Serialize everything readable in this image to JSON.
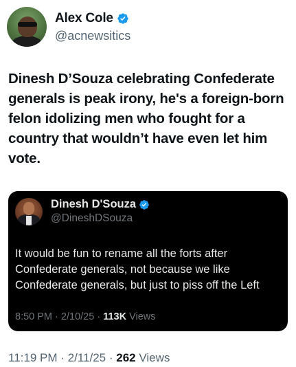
{
  "author": {
    "display_name": "Alex Cole",
    "handle": "@acnewsitics"
  },
  "tweet": {
    "text": "Dinesh D’Souza celebrating Confederate generals is peak irony, he's a foreign-born felon idolizing men who fought for a country that wouldn’t have even let him vote."
  },
  "quoted_tweet": {
    "display_name": "Dinesh D'Souza",
    "handle": "@DineshDSouza",
    "text": "It would be fun to rename all the forts after Confederate generals, not because we like Confederate generals, but just to piss off the Left",
    "time": "8:50 PM",
    "separator": "·",
    "date": "2/10/25",
    "views_count": "113K",
    "views_label": "Views"
  },
  "meta": {
    "time": "11:19 PM",
    "separator": "·",
    "date": "2/11/25",
    "views_count": "262",
    "views_label": "Views"
  },
  "colors": {
    "verified_blue": "#1d9bf0",
    "quote_background": "#000000",
    "secondary_text": "#536471"
  },
  "icons": {
    "verified": "verified-badge-icon"
  }
}
